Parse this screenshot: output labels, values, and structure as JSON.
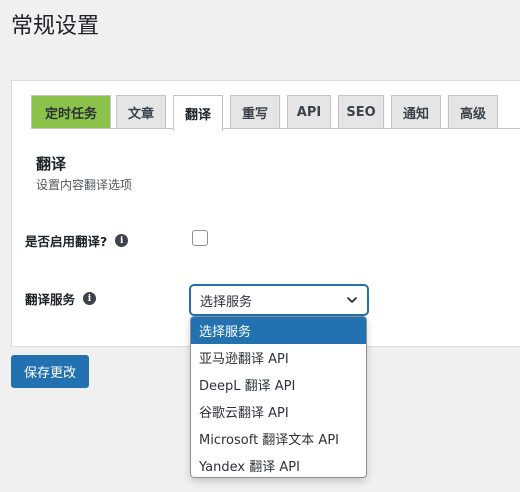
{
  "page": {
    "title": "常规设置"
  },
  "tabs": [
    {
      "label": "定时任务"
    },
    {
      "label": "文章"
    },
    {
      "label": "翻译"
    },
    {
      "label": "重写"
    },
    {
      "label": "API"
    },
    {
      "label": "SEO"
    },
    {
      "label": "通知"
    },
    {
      "label": "高级"
    }
  ],
  "section": {
    "title": "翻译",
    "description": "设置内容翻译选项"
  },
  "fields": {
    "enable_translation": {
      "label": "是否启用翻译?",
      "checked": false,
      "icon": "info-icon"
    },
    "translation_service": {
      "label": "翻译服务",
      "selected": "选择服务",
      "icon": "info-icon"
    }
  },
  "dropdown": {
    "options": [
      {
        "label": "选择服务"
      },
      {
        "label": "亚马逊翻译 API"
      },
      {
        "label": "DeepL 翻译 API"
      },
      {
        "label": "谷歌云翻译 API"
      },
      {
        "label": "Microsoft 翻译文本 API"
      },
      {
        "label": "Yandex 翻译 API"
      }
    ]
  },
  "buttons": {
    "save": "保存更改"
  },
  "colors": {
    "accent": "#2271b1",
    "tab_green": "#8bc34a",
    "background": "#f0f0f1"
  }
}
